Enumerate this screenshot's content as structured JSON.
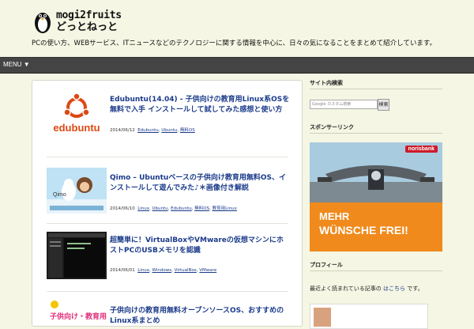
{
  "header": {
    "logo_line1": "mogi2fruits",
    "logo_line2": "どっとねっと",
    "tagline": "PCの使い方、WEBサービス、ITニュースなどのテクノロジーに関する情報を中心に、日々の気になることをまとめて紹介しています。"
  },
  "nav": {
    "menu_label": "MENU ▼"
  },
  "posts": [
    {
      "title": "Edubuntu(14.04) - 子供向けの教育用Linux系OSを無料で入手 インストールして試してみた感想と使い方",
      "date": "2014/06/12",
      "tags": [
        "Edubuntu",
        "Ubuntu",
        "無料OS"
      ],
      "thumb_label": "edubuntu"
    },
    {
      "title": "Qimo – Ubuntuベースの子供向け教育用無料OS、インストールして遊んでみた♪＊画像付き解説",
      "date": "2014/06/10",
      "tags": [
        "Linux",
        "Ubuntu",
        "Edubuntu",
        "無料OS",
        "教育用Linux"
      ],
      "thumb_label": "Qimo"
    },
    {
      "title": "超簡単に！VirtualBoxやVMwareの仮想マシンにホストPCのUSBメモリを認識",
      "date": "2014/06/01",
      "tags": [
        "Linux",
        "Windows",
        "VirtualBox",
        "VMware"
      ],
      "thumb_label": ""
    },
    {
      "title": "子供向けの教育用無料オープンソースOS、おすすめのLinux系まとめ",
      "date": "",
      "tags": [],
      "thumb_label": "子供向け・教育用"
    }
  ],
  "sidebar": {
    "search_heading": "サイト内検索",
    "search_placeholder": "Google カスタム検索",
    "search_button": "検索",
    "ad_heading": "スポンサーリンク",
    "ad_brand": "norisbank",
    "ad_line1": "MEHR",
    "ad_line2": "WÜNSCHE FREI!",
    "profile_heading": "プロフィール",
    "recent_text": "最近よく読まれている記事の",
    "recent_link": "はこちら",
    "recent_suffix": "です。"
  },
  "colors": {
    "background": "#f5f6e3",
    "nav": "#444444",
    "link": "#1a3a8a",
    "ubuntu": "#dd4814"
  }
}
